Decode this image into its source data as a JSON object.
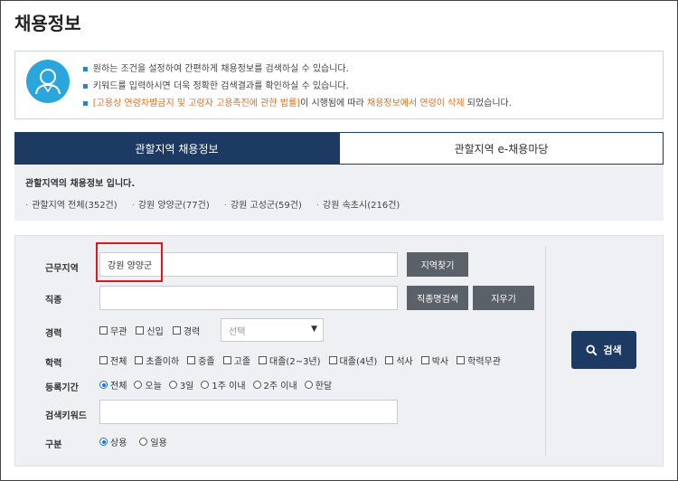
{
  "page": {
    "title": "채용정보"
  },
  "info": {
    "line1": "원하는 조건을 설정하여 간편하게 채용정보를 검색하실 수 있습니다.",
    "line2": "키워드를 입력하시면 더욱 정확한 검색결과를 확인하실 수 있습니다.",
    "line3_law": "[고용상 연령차별금지 및 고령자 고용촉진에 관한 법률]",
    "line3_mid": "이 시행됨에 따라 ",
    "line3_highlight": "채용정보에서 연령이 삭제",
    "line3_end": " 되었습니다."
  },
  "tabs": [
    {
      "label": "관할지역 채용정보",
      "active": true
    },
    {
      "label": "관할지역 e-채용마당",
      "active": false
    }
  ],
  "region": {
    "title": "관할지역의 채용정보 입니다.",
    "links": [
      "관할지역 전체(352건)",
      "강원 양양군(77건)",
      "강원 고성군(59건)",
      "강원 속초시(216건)"
    ]
  },
  "form": {
    "work_area": {
      "label": "근무지역",
      "value": "강원 양양군",
      "button": "지역찾기"
    },
    "job_type": {
      "label": "직종",
      "value": "",
      "button": "직종명검색",
      "clear_button": "지우기"
    },
    "career": {
      "label": "경력",
      "options": [
        "무관",
        "신입",
        "경력"
      ],
      "select_placeholder": "선택"
    },
    "education": {
      "label": "학력",
      "options": [
        "전체",
        "초졸이하",
        "중졸",
        "고졸",
        "대졸(2~3년)",
        "대졸(4년)",
        "석사",
        "박사",
        "학력무관"
      ]
    },
    "period": {
      "label": "등록기간",
      "options": [
        "전체",
        "오늘",
        "3일",
        "1주 이내",
        "2주 이내",
        "한달"
      ],
      "selected": 0
    },
    "keyword": {
      "label": "검색키워드",
      "value": ""
    },
    "category": {
      "label": "구분",
      "options": [
        "상용",
        "일용"
      ],
      "selected": 0
    },
    "search_button": "검색"
  },
  "colors": {
    "navy": "#1d3a63",
    "orange": "#e07020",
    "highlight_red": "#e8141a"
  }
}
